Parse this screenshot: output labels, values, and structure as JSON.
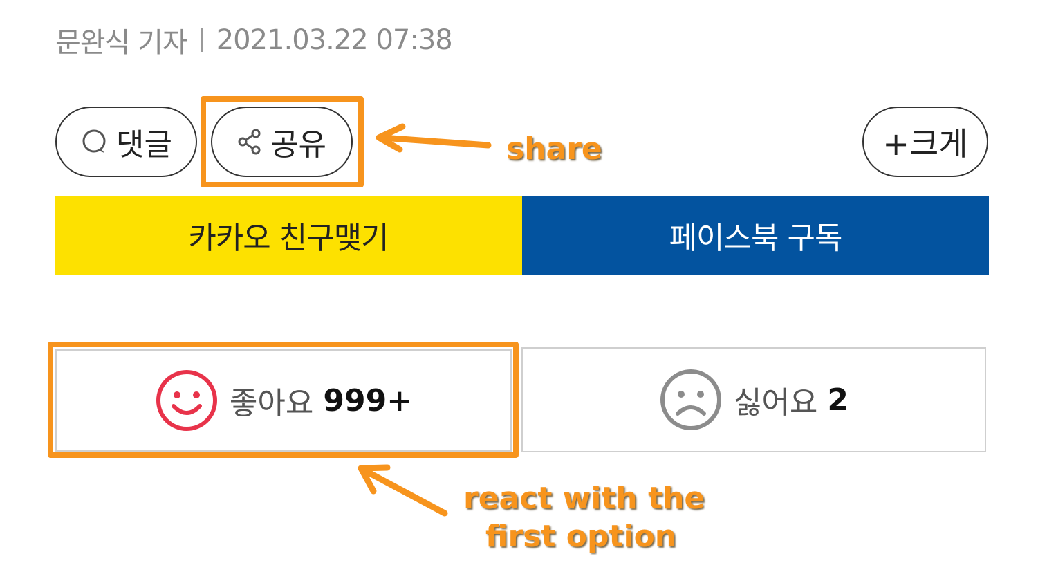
{
  "byline": {
    "author": "문완식 기자",
    "datetime": "2021.03.22 07:38"
  },
  "toolbar": {
    "comment_label": "댓글",
    "share_label": "공유",
    "enlarge_label": "+크게"
  },
  "subscribe": {
    "kakao_label": "카카오 친구맺기",
    "facebook_label": "페이스북 구독"
  },
  "reactions": {
    "like_label": "좋아요",
    "like_count": "999+",
    "dislike_label": "싫어요",
    "dislike_count": "2"
  },
  "annotations": {
    "share_note": "share",
    "react_note_line1": "react with the",
    "react_note_line2": "first option"
  },
  "colors": {
    "kakao_yellow": "#fde100",
    "facebook_blue": "#03539f",
    "annotation_orange": "#f7941d",
    "like_red": "#e8334a",
    "dislike_gray": "#8c8c8c"
  },
  "icons": {
    "comment": "comment-bubble-icon",
    "share": "share-icon",
    "like": "smile-face-icon",
    "dislike": "sad-face-icon"
  }
}
